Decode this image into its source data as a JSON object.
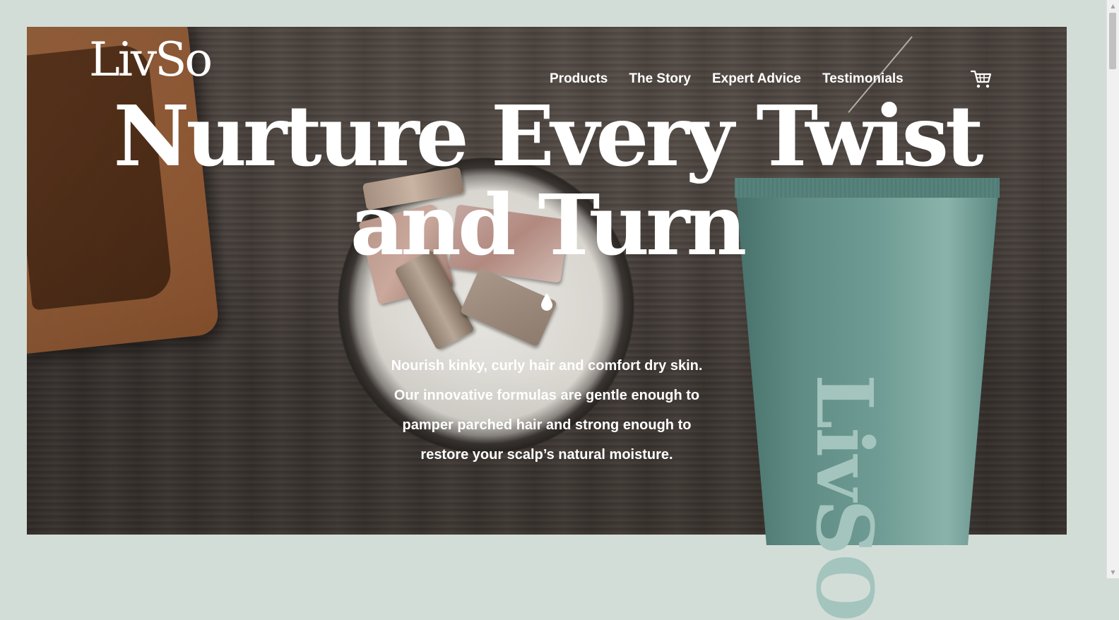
{
  "brand": {
    "logo_text": "LivSo"
  },
  "nav": {
    "items": [
      {
        "label": "Products"
      },
      {
        "label": "The Story"
      },
      {
        "label": "Expert Advice"
      },
      {
        "label": "Testimonials"
      }
    ],
    "cart_icon": "cart-icon"
  },
  "hero": {
    "headline_line1": "Nurture Every Twist",
    "headline_line2": "and Turn",
    "subtext_line1": "Nourish kinky, curly hair and comfort dry skin.",
    "subtext_line2": "Our innovative formulas are gentle enough to",
    "subtext_line3": "pamper parched hair and strong enough to",
    "subtext_line4": "restore your scalp’s natural moisture.",
    "product_label": "LivSO"
  },
  "colors": {
    "page_background": "#d3ddd8",
    "tube": "#5f8c84",
    "text": "#ffffff"
  }
}
